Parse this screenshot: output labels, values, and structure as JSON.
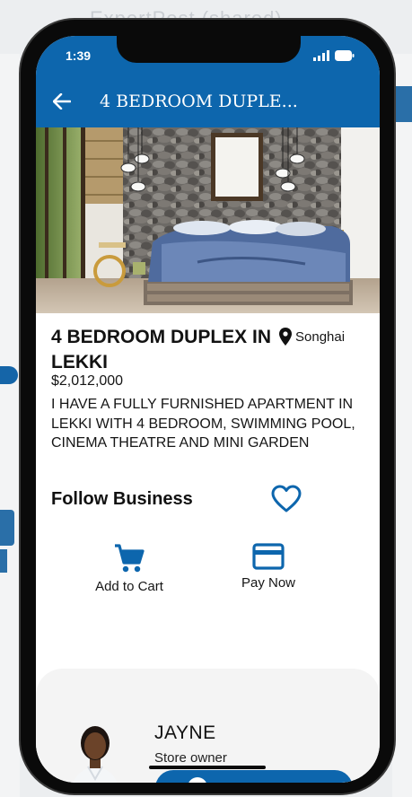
{
  "background": {
    "window_title": "ExpertPost (shared)"
  },
  "status_bar": {
    "time": "1:39"
  },
  "app_bar": {
    "title": "4 BEDROOM DUPLE...",
    "color": "#0d66ad"
  },
  "product": {
    "title": "4 BEDROOM DUPLEX IN LEKKI",
    "location": "Songhai",
    "price": "$2,012,000",
    "description": "I HAVE A FULLY FURNISHED APARTMENT IN LEKKI WITH 4 BEDROOM, SWIMMING POOL, CINEMA THEATRE AND MINI GARDEN"
  },
  "follow": {
    "label": "Follow Business"
  },
  "actions": {
    "add_to_cart": "Add to Cart",
    "pay_now": "Pay Now"
  },
  "owner": {
    "name": "JAYNE",
    "role": "Store owner"
  },
  "icons": {
    "back": "arrow-left-icon",
    "location": "map-pin-icon",
    "favorite": "heart-outline-icon",
    "cart": "shopping-cart-icon",
    "card": "credit-card-icon"
  },
  "accent_color": "#0d66ad"
}
